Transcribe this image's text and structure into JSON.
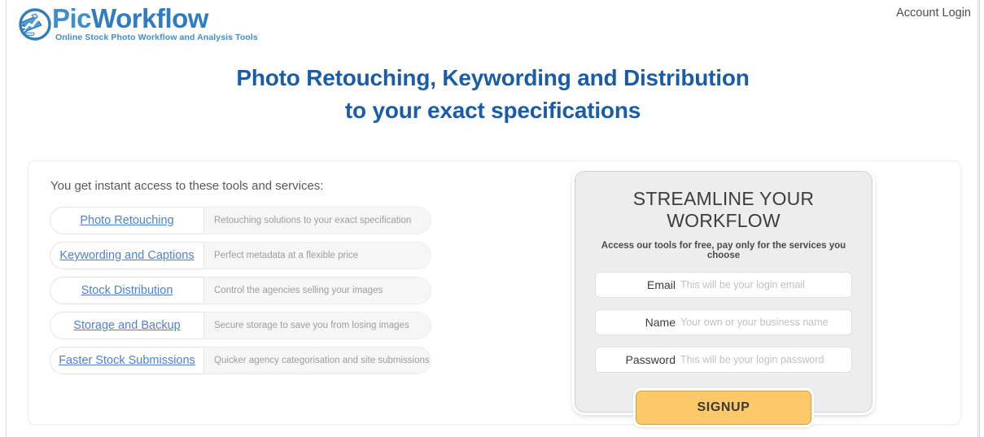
{
  "header": {
    "logo": {
      "icon": "camera-chart-circle-icon",
      "word_part1": "Pic",
      "word_part2": "Workflow",
      "tagline": "Online Stock Photo Workflow and Analysis Tools"
    },
    "account_login": "Account Login"
  },
  "headline": {
    "line1": "Photo Retouching, Keywording and Distribution",
    "line2": "to your exact specifications"
  },
  "left": {
    "intro": "You get instant access to these tools and services:",
    "features": [
      {
        "label": "Photo Retouching",
        "desc": "Retouching solutions to your exact specification"
      },
      {
        "label": "Keywording and Captions",
        "desc": "Perfect metadata at a flexible price"
      },
      {
        "label": "Stock Distribution",
        "desc": "Control the agencies selling your images"
      },
      {
        "label": "Storage and Backup",
        "desc": "Secure storage to save you from losing images"
      },
      {
        "label": "Faster Stock Submissions",
        "desc": "Quicker agency categorisation and site submissions"
      }
    ]
  },
  "signup": {
    "title": "STREAMLINE YOUR WORKFLOW",
    "subtitle": "Access our tools for free, pay only for the services you choose",
    "fields": [
      {
        "label": "Email",
        "value": "",
        "placeholder": "This will be your login email"
      },
      {
        "label": "Name",
        "value": "",
        "placeholder": "Your own or your business name"
      },
      {
        "label": "Password",
        "value": "",
        "placeholder": "This will be your login password"
      }
    ],
    "button": "SIGNUP"
  },
  "colors": {
    "headline_blue": "#1a5da6",
    "logo_blue": "#3f8ecb",
    "link_blue": "#4f7fd6",
    "button_amber": "#fbc969",
    "button_border": "#d9a03c",
    "panel_gray": "#ededed"
  }
}
